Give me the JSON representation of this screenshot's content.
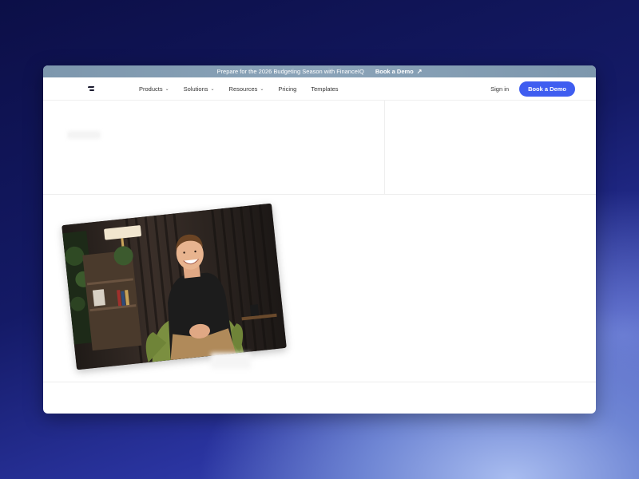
{
  "announcement": {
    "text": "Prepare for the 2026 Budgeting Season with FinanceIQ",
    "link_label": "Book a Demo",
    "link_icon": "arrow-up-right-icon"
  },
  "nav": {
    "logo": "brand-logo",
    "items": [
      {
        "label": "Products",
        "has_dropdown": true
      },
      {
        "label": "Solutions",
        "has_dropdown": true
      },
      {
        "label": "Resources",
        "has_dropdown": true
      },
      {
        "label": "Pricing",
        "has_dropdown": false
      },
      {
        "label": "Templates",
        "has_dropdown": false
      }
    ],
    "sign_in": "Sign in",
    "cta": "Book a Demo"
  },
  "media": {
    "video_thumbnail": "person-seated-video",
    "icon": "video-thumbnail"
  },
  "colors": {
    "accent": "#3f5df0",
    "announcement_bar": "#8aa3b8",
    "background_dark": "#141a66",
    "background_light": "#a9bdf0"
  }
}
